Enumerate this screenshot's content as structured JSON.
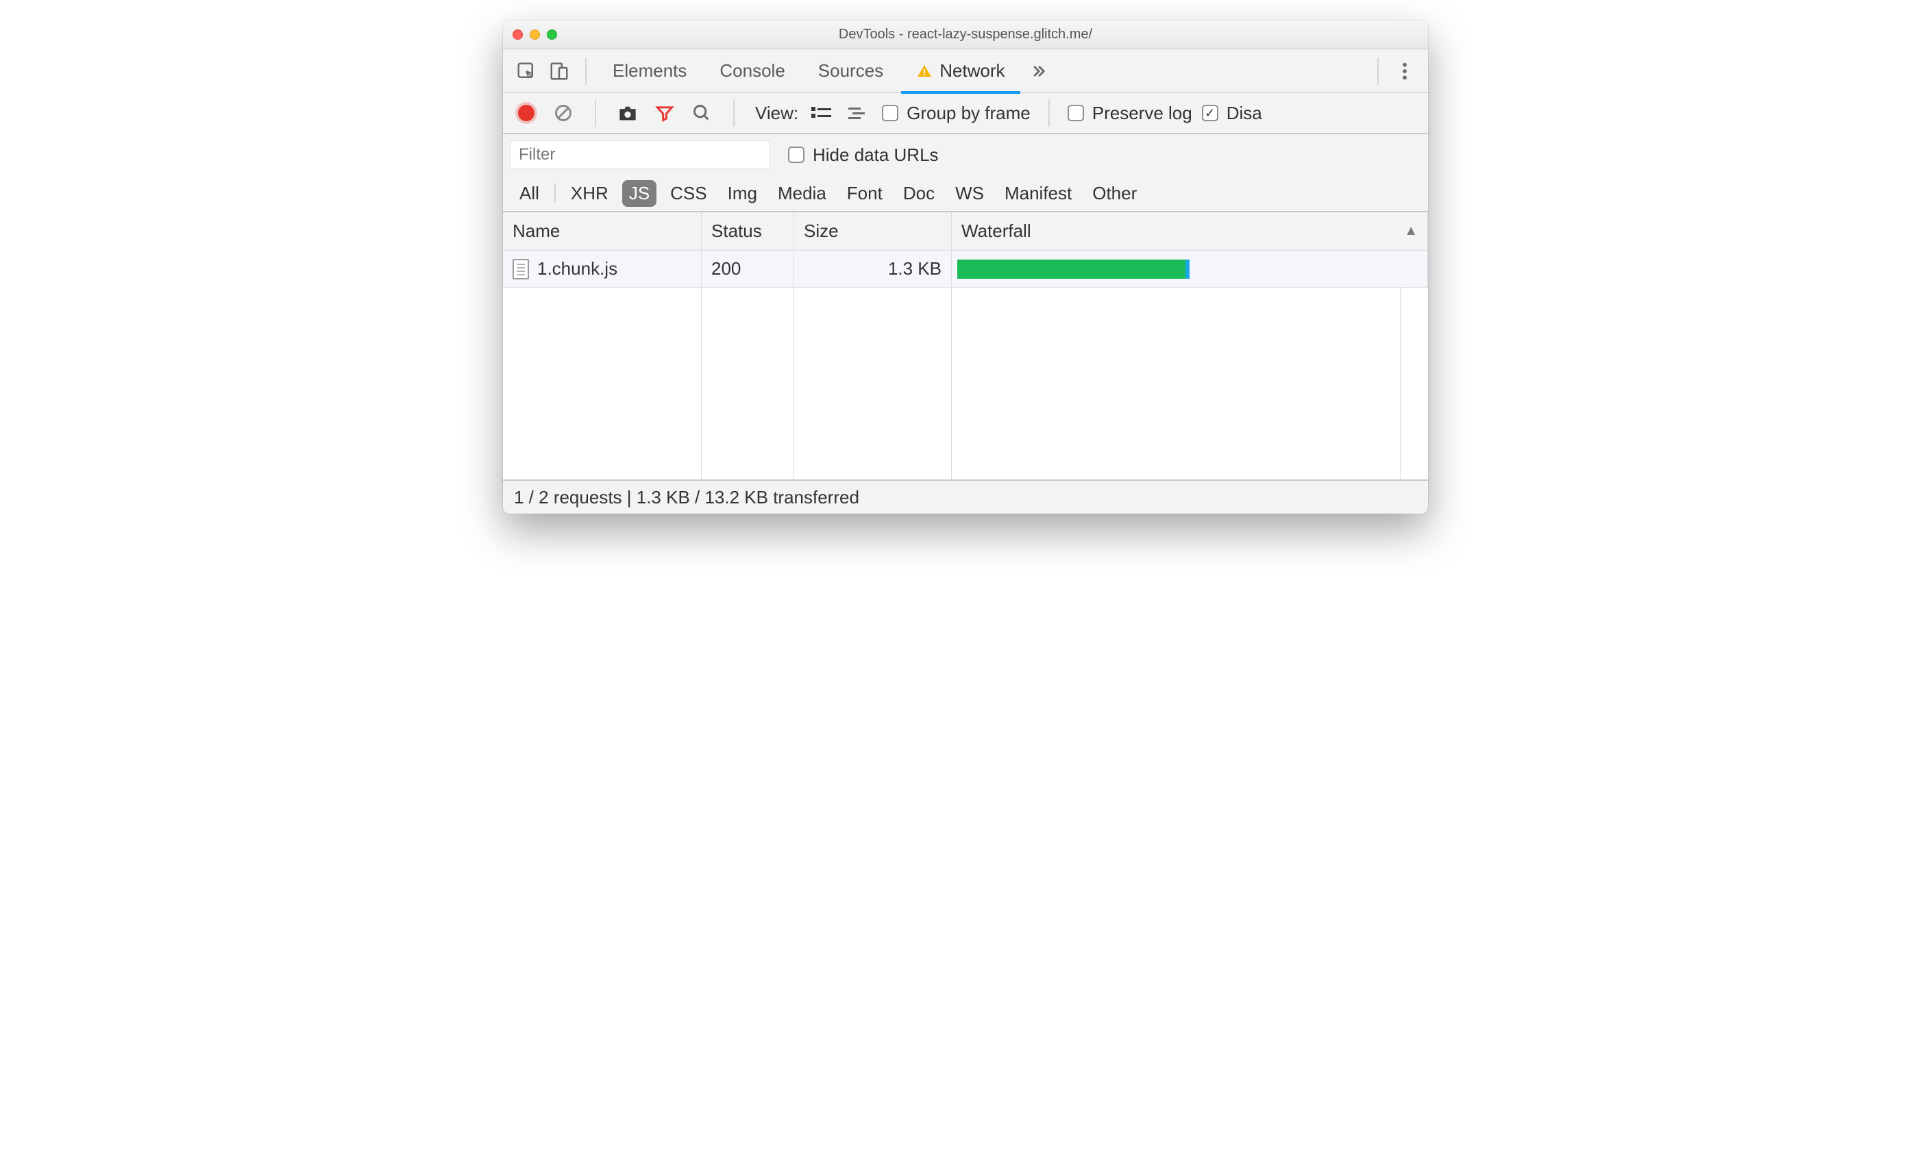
{
  "window_title": "DevTools - react-lazy-suspense.glitch.me/",
  "tabs": {
    "elements": "Elements",
    "console": "Console",
    "sources": "Sources",
    "network": "Network",
    "active": "network"
  },
  "toolbar": {
    "view_label": "View:",
    "group_by_frame": "Group by frame",
    "preserve_log": "Preserve log",
    "disable_cache": "Disa"
  },
  "filter": {
    "placeholder": "Filter",
    "hide_data_urls": "Hide data URLs"
  },
  "type_filters": [
    "All",
    "XHR",
    "JS",
    "CSS",
    "Img",
    "Media",
    "Font",
    "Doc",
    "WS",
    "Manifest",
    "Other"
  ],
  "type_selected": "JS",
  "columns": {
    "name": "Name",
    "status": "Status",
    "size": "Size",
    "waterfall": "Waterfall"
  },
  "rows": [
    {
      "name": "1.chunk.js",
      "status": "200",
      "size": "1.3 KB",
      "waterfall_pct": 50
    }
  ],
  "status_summary": "1 / 2 requests | 1.3 KB / 13.2 KB transferred"
}
